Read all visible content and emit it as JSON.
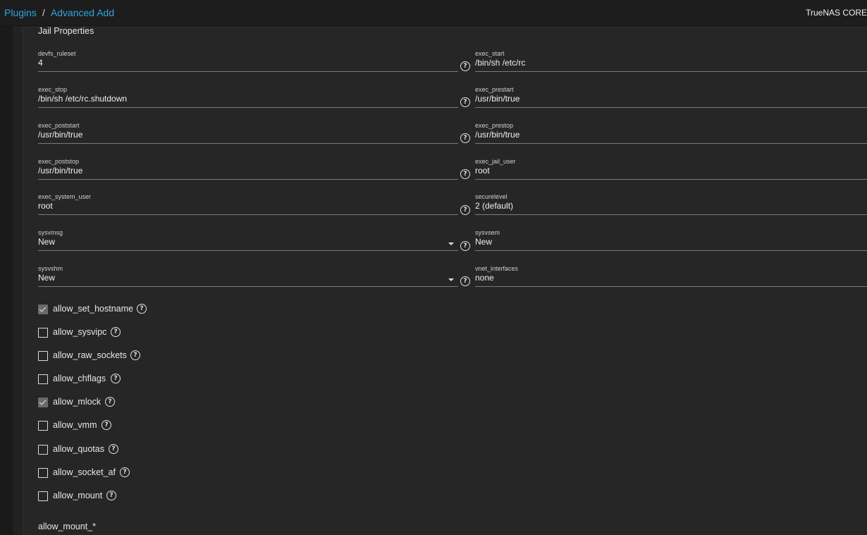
{
  "breadcrumb": {
    "parent": "Plugins",
    "separator": "/",
    "current": "Advanced Add"
  },
  "brand": "TrueNAS CORE",
  "section_title": "Jail Properties",
  "fields": {
    "devfs_ruleset": {
      "label": "devfs_ruleset",
      "value": "4"
    },
    "exec_start": {
      "label": "exec_start",
      "value": "/bin/sh /etc/rc"
    },
    "exec_stop": {
      "label": "exec_stop",
      "value": "/bin/sh /etc/rc.shutdown"
    },
    "exec_prestart": {
      "label": "exec_prestart",
      "value": "/usr/bin/true"
    },
    "exec_poststart": {
      "label": "exec_poststart",
      "value": "/usr/bin/true"
    },
    "exec_prestop": {
      "label": "exec_prestop",
      "value": "/usr/bin/true"
    },
    "exec_poststop": {
      "label": "exec_poststop",
      "value": "/usr/bin/true"
    },
    "exec_jail_user": {
      "label": "exec_jail_user",
      "value": "root"
    },
    "exec_system_user": {
      "label": "exec_system_user",
      "value": "root"
    },
    "securelevel": {
      "label": "securelevel",
      "value": "2 (default)"
    },
    "sysvmsg": {
      "label": "sysvmsg",
      "value": "New"
    },
    "sysvsem": {
      "label": "sysvsem",
      "value": "New"
    },
    "sysvshm": {
      "label": "sysvshm",
      "value": "New"
    },
    "vnet_interfaces": {
      "label": "vnet_interfaces",
      "value": "none"
    }
  },
  "help_icon": "question-circle-icon",
  "help_glyph": "?",
  "checkboxes": [
    {
      "label": "allow_set_hostname",
      "checked": true
    },
    {
      "label": "allow_sysvipc",
      "checked": false
    },
    {
      "label": "allow_raw_sockets",
      "checked": false
    },
    {
      "label": "allow_chflags",
      "checked": false
    },
    {
      "label": "allow_mlock",
      "checked": true
    },
    {
      "label": "allow_vmm",
      "checked": false
    },
    {
      "label": "allow_quotas",
      "checked": false
    },
    {
      "label": "allow_socket_af",
      "checked": false
    },
    {
      "label": "allow_mount",
      "checked": false
    }
  ],
  "subsection_title": "allow_mount_*"
}
